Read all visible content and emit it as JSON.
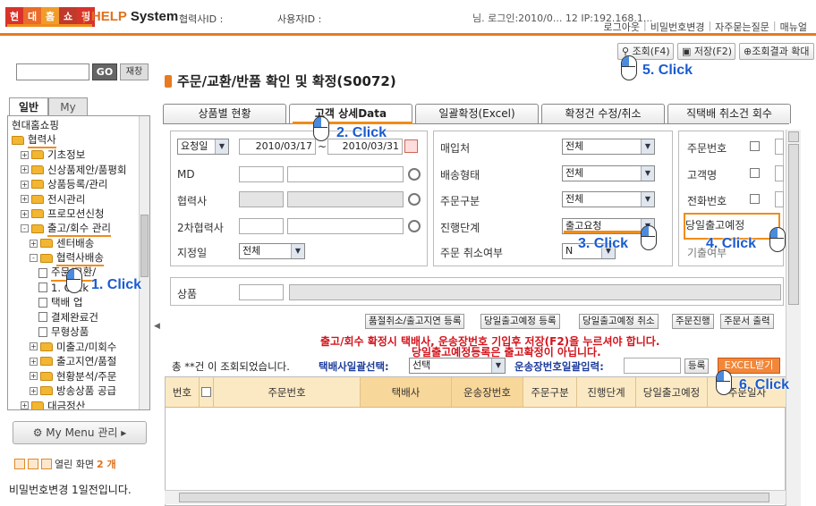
{
  "header": {
    "logo_chars": [
      "현",
      "대",
      "홈",
      "쇼",
      "핑"
    ],
    "system_prefix": "|",
    "system_help": "HELP",
    "system_name": "System",
    "partner_id_label": "협력사ID :",
    "user_id_label": "사용자ID :",
    "login_info": "님. 로그인:2010/0... 12 IP:192.168.1...",
    "links": [
      "로그아웃",
      "비밀번호변경",
      "자주묻는질문",
      "매뉴얼"
    ]
  },
  "sidebar": {
    "go_label": "GO",
    "reset_label": "재창",
    "tabs": [
      "일반",
      "My"
    ],
    "tree": [
      {
        "label": "현대홈쇼핑",
        "level": 0,
        "kind": "text"
      },
      {
        "label": "협력사",
        "level": 0,
        "kind": "folder",
        "highlight": true
      },
      {
        "label": "기초정보",
        "level": 1,
        "kind": "folder",
        "pm": "+"
      },
      {
        "label": "신상품제안/품평회",
        "level": 1,
        "kind": "folder",
        "pm": "+"
      },
      {
        "label": "상품등록/관리",
        "level": 1,
        "kind": "folder",
        "pm": "+"
      },
      {
        "label": "전시관리",
        "level": 1,
        "kind": "folder",
        "pm": "+"
      },
      {
        "label": "프로모션신청",
        "level": 1,
        "kind": "folder",
        "pm": "+"
      },
      {
        "label": "출고/회수 관리",
        "level": 1,
        "kind": "folder",
        "pm": "-",
        "highlight": true
      },
      {
        "label": "센터배송",
        "level": 2,
        "kind": "folder",
        "pm": "+"
      },
      {
        "label": "협력사배송",
        "level": 2,
        "kind": "folder",
        "pm": "-",
        "highlight": true
      },
      {
        "label": "주문/교환/",
        "level": 3,
        "kind": "doc",
        "highlight": true
      },
      {
        "label": "1. Click",
        "level": 3,
        "kind": "doc"
      },
      {
        "label": "택배 업",
        "level": 3,
        "kind": "doc"
      },
      {
        "label": "결제완료건",
        "level": 3,
        "kind": "doc"
      },
      {
        "label": "무형상품",
        "level": 3,
        "kind": "doc"
      },
      {
        "label": "미출고/미회수",
        "level": 2,
        "kind": "folder",
        "pm": "+"
      },
      {
        "label": "출고지연/품절",
        "level": 2,
        "kind": "folder",
        "pm": "+"
      },
      {
        "label": "현황분석/주문",
        "level": 2,
        "kind": "folder",
        "pm": "+"
      },
      {
        "label": "방송상품 공급",
        "level": 2,
        "kind": "folder",
        "pm": "+"
      },
      {
        "label": "대금정산",
        "level": 1,
        "kind": "folder",
        "pm": "+"
      }
    ],
    "mymenu_label": "My Menu 관리",
    "open_windows_label": "열린 화면",
    "open_windows_count": "2 개",
    "password_message": "비밀번호변경 1일전입니다."
  },
  "toolbar": {
    "search_label": "조회(F4)",
    "save_label": "저장(F2)",
    "expand_label": "조회결과 확대"
  },
  "page_title": "주문/교환/반품 확인 및 확정(S0072)",
  "tabs": [
    "상품별 현황",
    "고객 상세Data",
    "일괄확정(Excel)",
    "확정건 수정/취소",
    "직택배 취소건 회수"
  ],
  "filters": {
    "date_type": "요청일",
    "date_from": "2010/03/17",
    "date_sep": "~",
    "date_to": "2010/03/31",
    "md_label": "MD",
    "partner_label": "협력사",
    "sub_partner_label": "2차협력사",
    "designated_date_label": "지정일",
    "designated_date_value": "전체",
    "supplier_label": "매입처",
    "supplier_value": "전체",
    "delivery_type_label": "배송형태",
    "delivery_type_value": "전체",
    "order_type_label": "주문구분",
    "order_type_value": "전체",
    "progress_label": "진행단계",
    "progress_value": "출고요청",
    "cancel_label": "주문 취소여부",
    "cancel_value": "N",
    "order_no_label": "주문번호",
    "customer_label": "고객명",
    "phone_label": "전화번호",
    "sameday_label": "당일출고예정",
    "other_label": "기출여부",
    "product_label": "상품"
  },
  "actions": [
    "품절취소/출고지연 등록",
    "당일출고예정 등록",
    "당일출고예정 취소",
    "주문진행",
    "주문서 출력"
  ],
  "warnings": [
    "출고/회수 확정시 택배사, 운송장번호 기입후 저장(F2)을 누르셔야 합니다.",
    "당일출고예정등록은 출고확정이 아닙니다."
  ],
  "results": {
    "count_text": "총 **건   이 조회되었습니다.",
    "courier_select_label": "택배사일괄선택:",
    "courier_select_value": "선택",
    "tracking_label": "운송장번호일괄입력:",
    "register_label": "등록",
    "excel_label": "EXCEL받기"
  },
  "grid_columns": [
    "번호",
    "",
    "주문번호",
    "택배사",
    "운송장번호",
    "주문구분",
    "진행단계",
    "당일출고예정",
    "주문일자"
  ],
  "annotations": {
    "click1": "1. Click",
    "click2": "2. Click",
    "click3": "3. Click",
    "click4": "4. Click",
    "click5": "5. Click",
    "click6": "6. Click"
  },
  "colors": {
    "accent": "#e87a1f",
    "warning": "#d4141c",
    "link_blue": "#1e3d9c",
    "click_blue": "#1a5bd0"
  }
}
